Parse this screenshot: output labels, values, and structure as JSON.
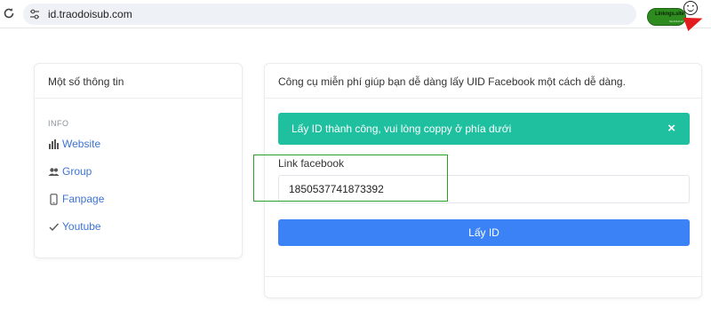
{
  "browser": {
    "url": "id.traodoisub.com",
    "extension_label": "Linkngs.site",
    "extension_sub": "NHANHCHI"
  },
  "info_card": {
    "title": "Một số thông tin",
    "section_label": "INFO",
    "items": [
      {
        "label": "Website",
        "icon": "bar-chart-icon"
      },
      {
        "label": "Group",
        "icon": "group-icon"
      },
      {
        "label": "Fanpage",
        "icon": "phone-icon"
      },
      {
        "label": "Youtube",
        "icon": "check-icon"
      }
    ]
  },
  "tool_card": {
    "title": "Công cụ miễn phí giúp bạn dễ dàng lấy UID Facebook một cách dễ dàng.",
    "alert_text": "Lấy ID thành công, vui lòng coppy ở phía dưới",
    "alert_close": "×",
    "field_label": "Link facebook",
    "field_value": "1850537741873392",
    "button_label": "Lấy ID"
  },
  "colors": {
    "alert_bg": "#1fc0a0",
    "button_bg": "#3b82f6",
    "link": "#3c74d4",
    "highlight": "#2aa02a"
  }
}
